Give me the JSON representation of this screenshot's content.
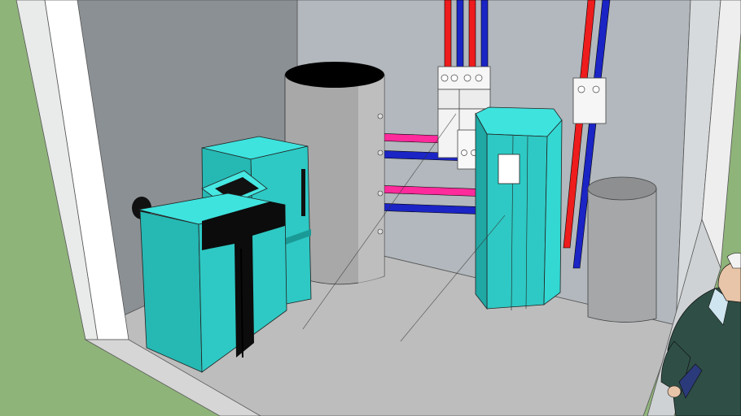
{
  "scene": {
    "colors": {
      "ground": "#8fb47a",
      "back_wall": "#b2b8bd",
      "left_wall": "#8d9296",
      "floor": "#bcbcbc",
      "boiler": "#2ec9c4",
      "boiler_light": "#3ee3de",
      "boiler_dark": "#1a9a96",
      "tank": "#a9a9a9",
      "pipe_hot_red": "#ee1c1c",
      "pipe_cold_blue": "#1b24c4",
      "pipe_hot_pink": "#ff2a9c",
      "outline": "#000000"
    }
  }
}
